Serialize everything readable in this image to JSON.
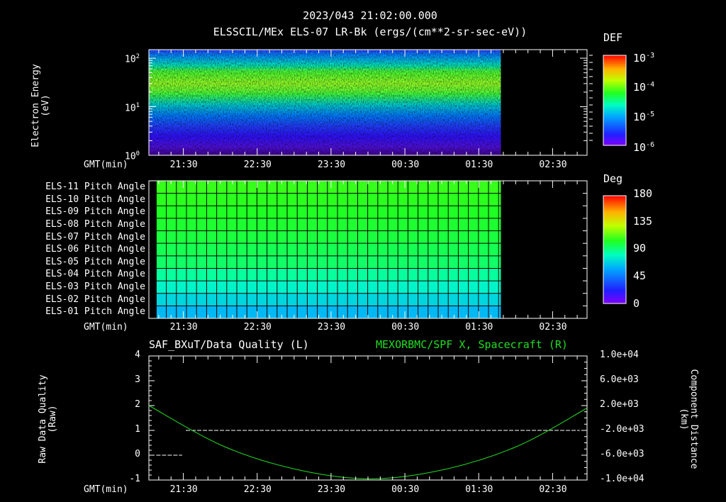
{
  "header": {
    "timestamp": "2023/043 21:02:00.000",
    "subtitle": "ELSSCIL/MEx ELS-07 LR-Bk  (ergs/(cm**2-sr-sec-eV))"
  },
  "panel1": {
    "ylabel_1": "Electron Energy",
    "ylabel_2": "(eV)",
    "yticks": [
      "10^0",
      "10^1",
      "10^2"
    ],
    "colorbar": {
      "title": "DEF",
      "labels": [
        {
          "base": "10",
          "exp": "-3"
        },
        {
          "base": "10",
          "exp": "-4"
        },
        {
          "base": "10",
          "exp": "-5"
        },
        {
          "base": "10",
          "exp": "-6"
        }
      ]
    }
  },
  "panel2": {
    "rows": [
      "ELS-11 Pitch Angle",
      "ELS-10 Pitch Angle",
      "ELS-09 Pitch Angle",
      "ELS-08 Pitch Angle",
      "ELS-07 Pitch Angle",
      "ELS-06 Pitch Angle",
      "ELS-05 Pitch Angle",
      "ELS-04 Pitch Angle",
      "ELS-03 Pitch Angle",
      "ELS-02 Pitch Angle",
      "ELS-01 Pitch Angle"
    ],
    "row_values_deg": [
      108,
      106,
      104,
      102,
      100,
      97,
      94,
      86,
      78,
      70,
      62
    ],
    "colorbar": {
      "title": "Deg",
      "labels": [
        "180",
        "135",
        "90",
        "45",
        "0"
      ]
    }
  },
  "panel3": {
    "left_title": "SAF_BXuT/Data Quality (L)",
    "right_title": "MEXORBMC/SPF X, Spacecraft (R)",
    "right_title_color": "#22dd22",
    "ylabel_left_1": "Raw Data Quality",
    "ylabel_left_2": "(Raw)",
    "ylabel_right_1": "Component Distance",
    "ylabel_right_2": "(km)",
    "yticks_left": [
      "4",
      "3",
      "2",
      "1",
      "0",
      "-1"
    ],
    "yticks_right": [
      "1.0e+04",
      "6.0e+03",
      "2.0e+03",
      "-2.0e+03",
      "-6.0e+03",
      "-1.0e+04"
    ]
  },
  "time_axis": {
    "label": "GMT(min)",
    "ticks": [
      "21:30",
      "22:30",
      "23:30",
      "00:30",
      "01:30",
      "02:30"
    ]
  },
  "chart_data": [
    {
      "type": "heatmap",
      "title": "ELSSCIL/MEx ELS-07 LR-Bk",
      "ylabel": "Electron Energy (eV)",
      "xlabel": "GMT(min)",
      "y_scale": "log",
      "ylim": [
        1,
        150
      ],
      "x_range_minutes": [
        "21:02",
        "02:58"
      ],
      "data_end": "01:48",
      "colorbar": {
        "label": "DEF",
        "scale": "log",
        "range": [
          1e-06,
          0.001
        ]
      },
      "peak_energy_band_eV": [
        20,
        60
      ]
    },
    {
      "type": "heatmap",
      "title": "Pitch Angle",
      "xlabel": "GMT(min)",
      "categories": [
        "ELS-11",
        "ELS-10",
        "ELS-09",
        "ELS-08",
        "ELS-07",
        "ELS-06",
        "ELS-05",
        "ELS-04",
        "ELS-03",
        "ELS-02",
        "ELS-01"
      ],
      "values_deg": [
        108,
        106,
        104,
        102,
        100,
        97,
        94,
        86,
        78,
        70,
        62
      ],
      "data_start": "21:08",
      "data_end": "01:48",
      "colorbar": {
        "label": "Deg",
        "range": [
          0,
          180
        ]
      }
    },
    {
      "type": "line",
      "xlabel": "GMT(min)",
      "series": [
        {
          "name": "SAF_BXuT/Data Quality (L)",
          "axis": "left",
          "color": "#ffffff",
          "segments": [
            {
              "x": [
                "21:08",
                "21:29"
              ],
              "y": 0
            },
            {
              "x": [
                "21:32",
                "02:52"
              ],
              "y": 1
            }
          ]
        },
        {
          "name": "MEXORBMC/SPF X, Spacecraft (R)",
          "axis": "right",
          "color": "#22dd22",
          "x": [
            "21:02",
            "22:02",
            "23:02",
            "00:02",
            "01:02",
            "02:02",
            "02:58"
          ],
          "y": [
            2000,
            -4500,
            -8300,
            -9800,
            -8300,
            -4500,
            1600
          ]
        }
      ],
      "ylim_left": [
        -1,
        4
      ],
      "ylim_right": [
        -10000,
        10000
      ]
    }
  ]
}
